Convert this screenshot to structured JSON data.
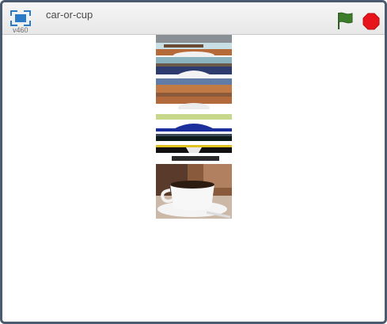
{
  "window": {
    "project_title": "car-or-cup",
    "version_label": "v460"
  },
  "icons": {
    "fullscreen": "fullscreen-icon",
    "green_flag": "green-flag-icon",
    "stop": "stop-sign-icon"
  },
  "colors": {
    "frame": "#4a5a6f",
    "fullscreen_blue": "#2a7ac7",
    "flag_green": "#3b7d2a",
    "stop_red": "#e8141b"
  }
}
